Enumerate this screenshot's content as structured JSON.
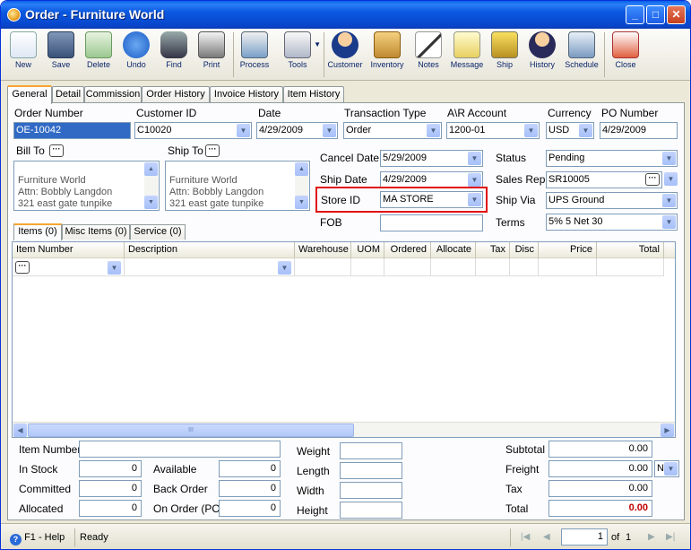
{
  "window": {
    "title": "Order - Furniture World"
  },
  "toolbar": {
    "items": [
      {
        "label": "New",
        "icon": "new-document-icon"
      },
      {
        "label": "Save",
        "icon": "save-disk-icon"
      },
      {
        "label": "Delete",
        "icon": "recycle-bin-icon"
      },
      {
        "label": "Undo",
        "icon": "undo-arrow-icon"
      },
      {
        "label": "Find",
        "icon": "binoculars-icon"
      },
      {
        "label": "Print",
        "icon": "printer-icon"
      },
      {
        "label": "Process",
        "icon": "process-icon"
      },
      {
        "label": "Tools",
        "icon": "tools-icon"
      },
      {
        "label": "Customer",
        "icon": "customer-icon"
      },
      {
        "label": "Inventory",
        "icon": "inventory-boxes-icon"
      },
      {
        "label": "Notes",
        "icon": "notes-pen-icon"
      },
      {
        "label": "Message",
        "icon": "message-icon"
      },
      {
        "label": "Ship",
        "icon": "forklift-icon"
      },
      {
        "label": "History",
        "icon": "history-icon"
      },
      {
        "label": "Schedule",
        "icon": "schedule-icon"
      },
      {
        "label": "Close",
        "icon": "close-door-icon"
      }
    ]
  },
  "tabs": [
    "General",
    "Detail",
    "Commission",
    "Order History",
    "Invoice History",
    "Item History"
  ],
  "header": {
    "order_number_label": "Order Number",
    "order_number": "OE-10042",
    "customer_id_label": "Customer ID",
    "customer_id": "C10020",
    "date_label": "Date",
    "date": "4/29/2009",
    "transaction_type_label": "Transaction Type",
    "transaction_type": "Order",
    "ar_account_label": "A\\R Account",
    "ar_account": "1200-01",
    "currency_label": "Currency",
    "currency": "USD",
    "po_number_label": "PO Number",
    "po_number": "4/29/2009"
  },
  "bill_to": {
    "label": "Bill To",
    "lines": "Furniture World\nAttn: Bobbly Langdon\n321 east gate tunpike\nHuntington Station, NY"
  },
  "ship_to": {
    "label": "Ship To",
    "lines": "Furniture World\nAttn: Bobbly Langdon\n321 east gate tunpike\nHuntington Station, NY"
  },
  "details": {
    "cancel_date_label": "Cancel Date",
    "cancel_date": "5/29/2009",
    "ship_date_label": "Ship Date",
    "ship_date": "4/29/2009",
    "store_id_label": "Store ID",
    "store_id": "MA STORE",
    "fob_label": "FOB",
    "fob": "",
    "status_label": "Status",
    "status": "Pending",
    "sales_rep_label": "Sales Rep",
    "sales_rep": "SR10005",
    "ship_via_label": "Ship Via",
    "ship_via": "UPS Ground",
    "terms_label": "Terms",
    "terms": "5% 5 Net 30"
  },
  "subtabs": [
    "Items (0)",
    "Misc Items (0)",
    "Service (0)"
  ],
  "grid": {
    "columns": [
      "Item Number",
      "Description",
      "Warehouse",
      "UOM",
      "Ordered",
      "Allocate",
      "Tax",
      "Disc",
      "Price",
      "Total"
    ]
  },
  "footer": {
    "item_number_label": "Item Number",
    "in_stock_label": "In Stock",
    "in_stock": "0",
    "committed_label": "Committed",
    "committed": "0",
    "allocated_label": "Allocated",
    "allocated": "0",
    "available_label": "Available",
    "available": "0",
    "back_order_label": "Back Order",
    "back_order": "0",
    "on_order_label": "On Order (PO)",
    "on_order": "0",
    "weight_label": "Weight",
    "length_label": "Length",
    "width_label": "Width",
    "height_label": "Height",
    "subtotal_label": "Subtotal",
    "subtotal": "0.00",
    "freight_label": "Freight",
    "freight": "0.00",
    "freight_code": "N",
    "tax_label": "Tax",
    "tax": "0.00",
    "total_label": "Total",
    "total": "0.00"
  },
  "status_bar": {
    "help": "F1 - Help",
    "status": "Ready",
    "page": "1",
    "of_label": "of",
    "page_count": "1"
  },
  "colors": {
    "highlight_border": "#e01010",
    "total_value": "#c00000",
    "selection": "#316ac5"
  }
}
